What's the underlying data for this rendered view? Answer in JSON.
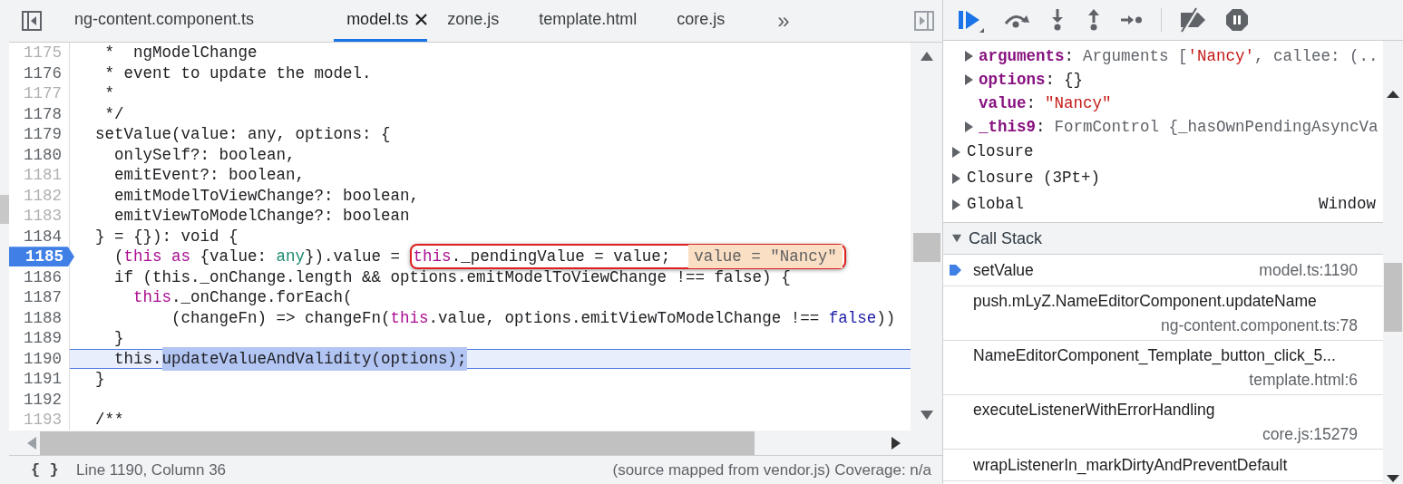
{
  "tabs": [
    {
      "label": "ng-content.component.ts",
      "selected": false,
      "closable": false
    },
    {
      "label": "model.ts",
      "selected": true,
      "closable": true
    },
    {
      "label": "zone.js",
      "selected": false,
      "closable": false
    },
    {
      "label": "template.html",
      "selected": false,
      "closable": false
    },
    {
      "label": "core.js",
      "selected": false,
      "closable": false
    }
  ],
  "more_tabs": "»",
  "code_lines": [
    {
      "number": "1175",
      "muted": true,
      "breakpoint": false,
      "current": false,
      "tokens": [
        {
          "text": "   *  ngModelChange",
          "kind": "plain"
        }
      ]
    },
    {
      "number": "1176",
      "muted": false,
      "breakpoint": false,
      "current": false,
      "tokens": [
        {
          "text": "   * event to update the model.",
          "kind": "plain"
        }
      ]
    },
    {
      "number": "1177",
      "muted": true,
      "breakpoint": false,
      "current": false,
      "tokens": [
        {
          "text": "   *",
          "kind": "plain"
        }
      ]
    },
    {
      "number": "1178",
      "muted": false,
      "breakpoint": false,
      "current": false,
      "tokens": [
        {
          "text": "   */",
          "kind": "plain"
        }
      ]
    },
    {
      "number": "1179",
      "muted": false,
      "breakpoint": false,
      "current": false,
      "tokens": [
        {
          "text": "  setValue(value: any, options: {",
          "kind": "plain"
        }
      ]
    },
    {
      "number": "1180",
      "muted": false,
      "breakpoint": false,
      "current": false,
      "tokens": [
        {
          "text": "    onlySelf?: boolean,",
          "kind": "plain"
        }
      ]
    },
    {
      "number": "1181",
      "muted": true,
      "breakpoint": false,
      "current": false,
      "tokens": [
        {
          "text": "    emitEvent?: boolean,",
          "kind": "plain"
        }
      ]
    },
    {
      "number": "1182",
      "muted": true,
      "breakpoint": false,
      "current": false,
      "tokens": [
        {
          "text": "    emitModelToViewChange?: boolean,",
          "kind": "plain"
        }
      ]
    },
    {
      "number": "1183",
      "muted": true,
      "breakpoint": false,
      "current": false,
      "tokens": [
        {
          "text": "    emitViewToModelChange?: boolean",
          "kind": "plain"
        }
      ]
    },
    {
      "number": "1184",
      "muted": false,
      "breakpoint": false,
      "current": false,
      "tokens": [
        {
          "text": "  } = {}): void {",
          "kind": "plain"
        }
      ]
    },
    {
      "number": "1185",
      "muted": false,
      "breakpoint": true,
      "current": false,
      "tokens": [
        {
          "text": "    (",
          "kind": "plain"
        },
        {
          "text": "this",
          "kind": "keyword"
        },
        {
          "text": " as",
          "kind": "keyword"
        },
        {
          "text": " {value: ",
          "kind": "plain"
        },
        {
          "text": "any",
          "kind": "type"
        },
        {
          "text": "}).value = ",
          "kind": "plain"
        }
      ],
      "callout": {
        "tokens": [
          {
            "text": "this",
            "kind": "keyword"
          },
          {
            "text": "._pendingValue = value;",
            "kind": "plain"
          }
        ],
        "inline_value": "value = \"Nancy\""
      }
    },
    {
      "number": "1186",
      "muted": false,
      "breakpoint": false,
      "current": false,
      "tokens": [
        {
          "text": "    if (this._onChange.length && options.emitModelToViewChange !== false) {",
          "kind": "plain"
        }
      ]
    },
    {
      "number": "1187",
      "muted": false,
      "breakpoint": false,
      "current": false,
      "tokens": [
        {
          "text": "      this",
          "kind": "keyword"
        },
        {
          "text": "._onChange.forEach(",
          "kind": "plain"
        }
      ]
    },
    {
      "number": "1188",
      "muted": false,
      "breakpoint": false,
      "current": false,
      "tokens": [
        {
          "text": "          (changeFn) => changeFn(",
          "kind": "plain"
        },
        {
          "text": "this",
          "kind": "keyword"
        },
        {
          "text": ".value, options.emitViewToModelChange !== ",
          "kind": "plain"
        },
        {
          "text": "false",
          "kind": "literal"
        },
        {
          "text": "))",
          "kind": "plain"
        }
      ]
    },
    {
      "number": "1189",
      "muted": false,
      "breakpoint": false,
      "current": false,
      "tokens": [
        {
          "text": "    }",
          "kind": "plain"
        }
      ]
    },
    {
      "number": "1190",
      "muted": false,
      "breakpoint": false,
      "current": true,
      "tokens": [
        {
          "text": "    this.",
          "kind": "plain"
        },
        {
          "text": "updateValueAndValidity(options);",
          "kind": "selection"
        }
      ]
    },
    {
      "number": "1191",
      "muted": false,
      "breakpoint": false,
      "current": false,
      "tokens": [
        {
          "text": "  }",
          "kind": "plain"
        }
      ]
    },
    {
      "number": "1192",
      "muted": false,
      "breakpoint": false,
      "current": false
    },
    {
      "number": "1193",
      "muted": true,
      "breakpoint": false,
      "current": false,
      "tokens": [
        {
          "text": "  /**",
          "kind": "plain"
        }
      ]
    }
  ],
  "status_bar": {
    "icon": "{ }",
    "position": "Line 1190, Column 36",
    "info": "(source mapped from vendor.js) Coverage: n/a"
  },
  "local_variables": [
    {
      "name": "arguments",
      "separator": ":",
      "expandable": true,
      "value": [
        {
          "text": "Arguments [",
          "kind": "object"
        },
        {
          "text": "'Nancy'",
          "kind": "string"
        },
        {
          "text": ", callee: (..",
          "kind": "object"
        }
      ]
    },
    {
      "name": "options",
      "separator": ":",
      "expandable": true,
      "value": [
        {
          "text": "{}",
          "kind": "plain"
        }
      ]
    },
    {
      "name": "value",
      "separator": ":",
      "expandable": false,
      "value": [
        {
          "text": "\"Nancy\"",
          "kind": "string"
        }
      ]
    },
    {
      "name": "_this9",
      "separator": ":",
      "expandable": true,
      "value": [
        {
          "text": "FormControl {_hasOwnPendingAsyncVa",
          "kind": "object"
        }
      ]
    }
  ],
  "scopes": [
    {
      "name": "Closure"
    },
    {
      "name": "Closure (3Pt+)"
    },
    {
      "name": "Global",
      "value": "Window"
    }
  ],
  "call_stack": {
    "title": "Call Stack",
    "expanded": true,
    "frames": [
      {
        "function": "setValue",
        "location": "model.ts:1190",
        "selected": true
      },
      {
        "function": "push.mLyZ.NameEditorComponent.updateName",
        "location": "ng-content.component.ts:78",
        "selected": false
      },
      {
        "function": "NameEditorComponent_Template_button_click_5...",
        "location": "template.html:6",
        "selected": false
      },
      {
        "function": "executeListenerWithErrorHandling",
        "location": "core.js:15279",
        "selected": false
      },
      {
        "function": "wrapListenerIn_markDirtyAndPreventDefault",
        "selected": false
      }
    ]
  }
}
